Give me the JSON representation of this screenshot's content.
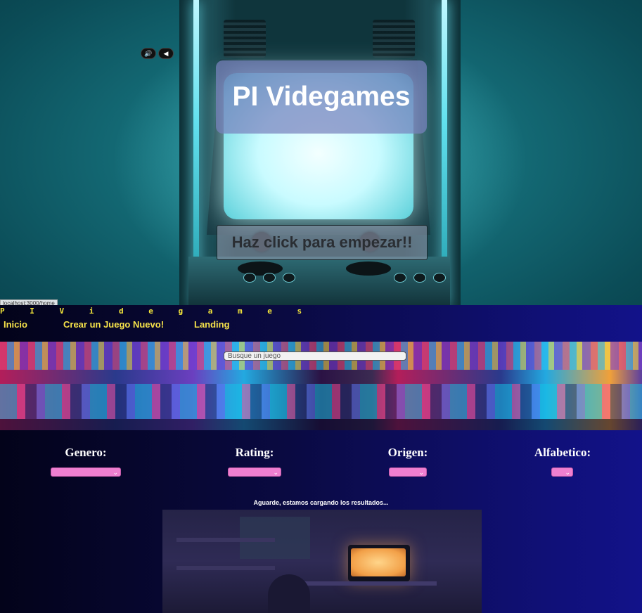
{
  "landing": {
    "title": "PI Videgames",
    "start_button": "Haz click para empezar!!",
    "audio_controls": [
      {
        "icon": "speaker-on-icon",
        "glyph": "🔊"
      },
      {
        "icon": "mute-icon",
        "glyph": "◀"
      }
    ],
    "status_url": "localhost:3000/home"
  },
  "home": {
    "brand": "P I  V i d e g a m e s",
    "nav": [
      "Inicio",
      "Crear un Juego Nuevo!",
      "Landing"
    ],
    "search_placeholder": "Busque un juego",
    "filters": [
      {
        "label": "Genero:"
      },
      {
        "label": "Rating:"
      },
      {
        "label": "Origen:"
      },
      {
        "label": "Alfabetico:"
      }
    ],
    "loading_text": "Aguarde, estamos cargando los resultados..."
  },
  "colors": {
    "accent_yellow": "#f7e34a",
    "select_pink": "#ef7fd0",
    "nav_background": "#0a0a42"
  }
}
